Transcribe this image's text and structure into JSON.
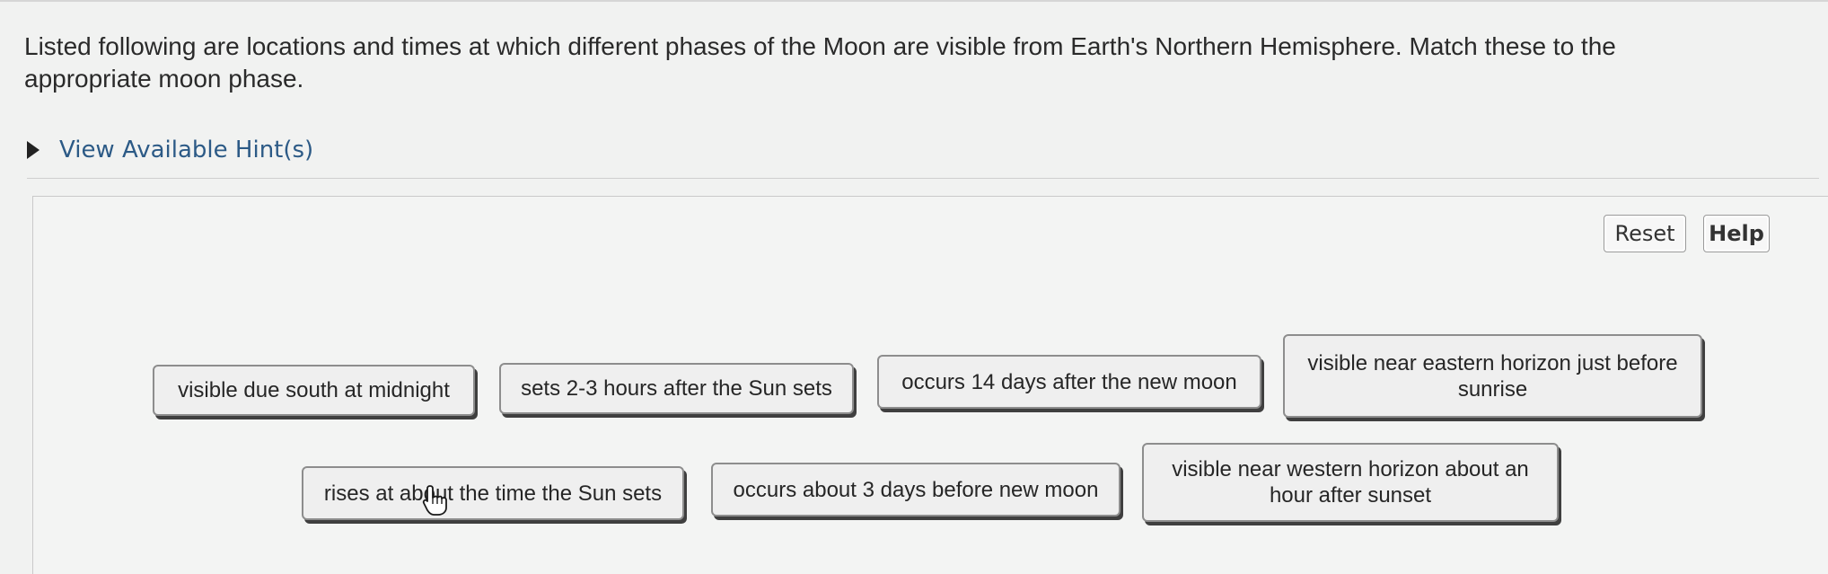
{
  "question": {
    "text": "Listed following are locations and times at which different phases of the Moon are visible from Earth's Northern Hemisphere. Match these to the appropriate moon phase."
  },
  "hint": {
    "label": "View Available Hint(s)",
    "expand_icon": "triangle-right-icon"
  },
  "toolbar": {
    "reset_label": "Reset",
    "help_label": "Help"
  },
  "labels": [
    "visible due south at midnight",
    "sets 2-3 hours after the Sun sets",
    "occurs 14 days after the new moon",
    "visible near eastern horizon just before sunrise",
    "rises at about the time the Sun sets",
    "occurs about 3 days before new moon",
    "visible near western horizon about an hour after sunset"
  ],
  "cursor_icon": "hand-pointer-icon",
  "colors": {
    "hint_link": "#2c5a86",
    "background": "#f1f2f1",
    "chip_shadow": "#3f3f3f"
  }
}
